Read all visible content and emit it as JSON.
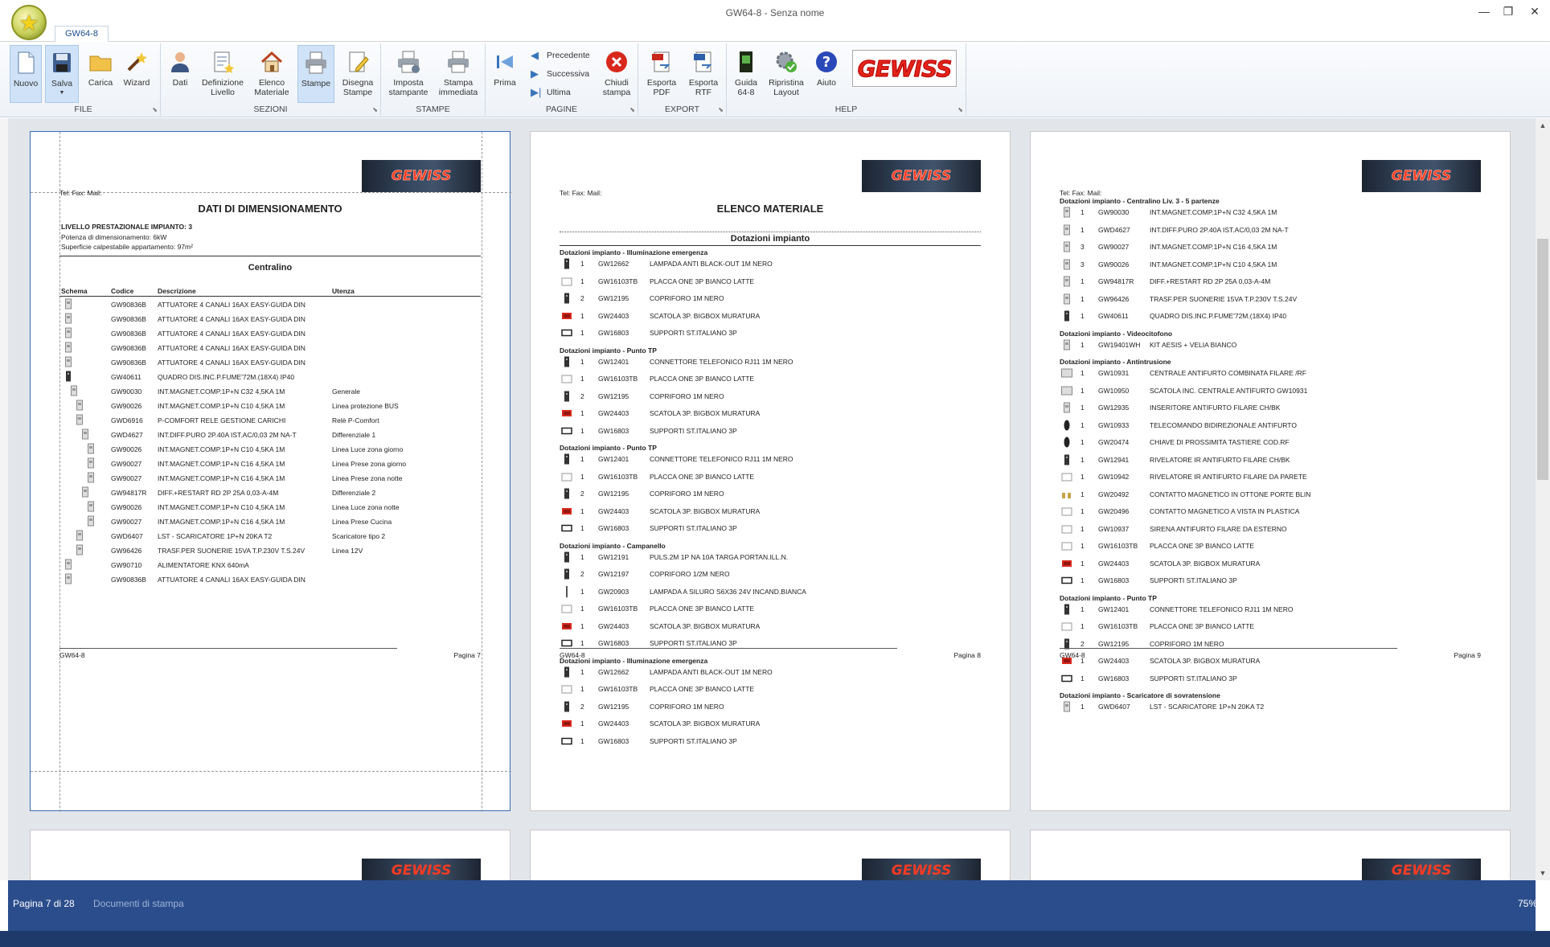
{
  "window": {
    "title": "GW64-8 - Senza nome",
    "tab": "GW64-8"
  },
  "ribbon": {
    "groups": [
      "FILE",
      "SEZIONI",
      "STAMPE",
      "PAGINE",
      "EXPORT",
      "HELP"
    ],
    "buttons": {
      "nuovo": "Nuovo",
      "salva": "Salva",
      "carica": "Carica",
      "wizard": "Wizard",
      "dati": "Dati",
      "definizione": "Definizione\nLivello",
      "elenco": "Elenco\nMateriale",
      "stampe": "Stampe",
      "disegna": "Disegna\nStampe",
      "imposta": "Imposta\nstampante",
      "immediata": "Stampa\nimmediata",
      "prima": "Prima",
      "precedente": "Precedente",
      "successiva": "Successiva",
      "ultima": "Ultima",
      "chiudi": "Chiudi\nstampa",
      "pdf": "Esporta\nPDF",
      "rtf": "Esporta\nRTF",
      "guida": "Guida\n64-8",
      "ripristina": "Ripristina\nLayout",
      "aiuto": "Aiuto"
    },
    "logo": "GEWISS"
  },
  "common": {
    "contact": "Tel:  Fax:  Mail:",
    "logo": "GEWISS",
    "footer_left": "GW64-8"
  },
  "page7": {
    "title": "DATI DI DIMENSIONAMENTO",
    "level": "LIVELLO PRESTAZIONALE IMPIANTO: 3",
    "power": "Potenza di dimensionamento: 6kW",
    "surface": "Superficie calpestabile appartamento: 97m²",
    "section": "Centralino",
    "headers": [
      "Schema",
      "Codice",
      "Descrizione",
      "Utenza"
    ],
    "rows": [
      [
        "0",
        "GW90836B",
        "ATTUATORE 4 CANALI 16AX EASY-GUIDA DIN",
        ""
      ],
      [
        "0",
        "GW90836B",
        "ATTUATORE 4 CANALI 16AX EASY-GUIDA DIN",
        ""
      ],
      [
        "0",
        "GW90836B",
        "ATTUATORE 4 CANALI 16AX EASY-GUIDA DIN",
        ""
      ],
      [
        "0",
        "GW90836B",
        "ATTUATORE 4 CANALI 16AX EASY-GUIDA DIN",
        ""
      ],
      [
        "0",
        "GW90836B",
        "ATTUATORE 4 CANALI 16AX EASY-GUIDA DIN",
        ""
      ],
      [
        "0",
        "GW40611",
        "QUADRO DIS.INC.P.FUME'72M.(18X4) IP40",
        ""
      ],
      [
        "1",
        "GW90030",
        "INT.MAGNET.COMP.1P+N C32 4,5KA 1M",
        "Generale"
      ],
      [
        "2",
        "GW90026",
        "INT.MAGNET.COMP.1P+N C10 4,5KA 1M",
        "Linea protezione BUS"
      ],
      [
        "2",
        "GWD6916",
        "P-COMFORT RELE GESTIONE CARICHI",
        "Relè P-Comfort"
      ],
      [
        "3",
        "GWD4627",
        "INT.DIFF.PURO 2P.40A IST.AC/0,03 2M NA-T",
        "Differenziale 1"
      ],
      [
        "4",
        "GW90026",
        "INT.MAGNET.COMP.1P+N C10 4,5KA 1M",
        "Linea Luce zona giorno"
      ],
      [
        "4",
        "GW90027",
        "INT.MAGNET.COMP.1P+N C16 4,5KA 1M",
        "Linea Prese zona giorno"
      ],
      [
        "4",
        "GW90027",
        "INT.MAGNET.COMP.1P+N C16 4,5KA 1M",
        "Linea Prese zona notte"
      ],
      [
        "3",
        "GW94817R",
        "DIFF.+RESTART RD 2P 25A 0,03-A-4M",
        "Differenziale 2"
      ],
      [
        "4",
        "GW90026",
        "INT.MAGNET.COMP.1P+N C10 4,5KA 1M",
        "Linea Luce zona notte"
      ],
      [
        "4",
        "GW90027",
        "INT.MAGNET.COMP.1P+N C16 4,5KA 1M",
        "Linea Prese Cucina"
      ],
      [
        "2",
        "GWD6407",
        "LST - SCARICATORE 1P+N 20KA T2",
        "Scaricatore tipo 2"
      ],
      [
        "2",
        "GW96426",
        "TRASF.PER SUONERIE 15VA T.P.230V T.S.24V",
        "Linea 12V"
      ],
      [
        "0",
        "GW90710",
        "ALIMENTATORE KNX 640mA",
        ""
      ],
      [
        "0",
        "GW90836B",
        "ATTUATORE 4 CANALI 16AX EASY-GUIDA DIN",
        ""
      ]
    ],
    "footer_right": "Pagina 7"
  },
  "page8": {
    "title": "ELENCO MATERIALE",
    "subtitle": "Dotazioni impianto",
    "groups": [
      {
        "name": "Dotazioni impianto - Illuminazione emergenza",
        "items": [
          [
            "dark",
            "1",
            "GW12662",
            "LAMPADA ANTI BLACK-OUT 1M NERO"
          ],
          [
            "white",
            "1",
            "GW16103TB",
            "PLACCA ONE 3P BIANCO LATTE"
          ],
          [
            "dark",
            "2",
            "GW12195",
            "COPRIFORO 1M NERO"
          ],
          [
            "red",
            "1",
            "GW24403",
            "SCATOLA 3P. BIGBOX MURATURA"
          ],
          [
            "frame",
            "1",
            "GW16803",
            "SUPPORTI ST.ITALIANO 3P"
          ]
        ]
      },
      {
        "name": "Dotazioni impianto - Punto TP",
        "items": [
          [
            "dark",
            "1",
            "GW12401",
            "CONNETTORE TELEFONICO RJ11 1M NERO"
          ],
          [
            "white",
            "1",
            "GW16103TB",
            "PLACCA ONE 3P BIANCO LATTE"
          ],
          [
            "dark",
            "2",
            "GW12195",
            "COPRIFORO 1M NERO"
          ],
          [
            "red",
            "1",
            "GW24403",
            "SCATOLA 3P. BIGBOX MURATURA"
          ],
          [
            "frame",
            "1",
            "GW16803",
            "SUPPORTI ST.ITALIANO 3P"
          ]
        ]
      },
      {
        "name": "Dotazioni impianto - Punto TP",
        "items": [
          [
            "dark",
            "1",
            "GW12401",
            "CONNETTORE TELEFONICO RJ11 1M NERO"
          ],
          [
            "white",
            "1",
            "GW16103TB",
            "PLACCA ONE 3P BIANCO LATTE"
          ],
          [
            "dark",
            "2",
            "GW12195",
            "COPRIFORO 1M NERO"
          ],
          [
            "red",
            "1",
            "GW24403",
            "SCATOLA 3P. BIGBOX MURATURA"
          ],
          [
            "frame",
            "1",
            "GW16803",
            "SUPPORTI ST.ITALIANO 3P"
          ]
        ]
      },
      {
        "name": "Dotazioni impianto - Campanello",
        "items": [
          [
            "dark",
            "1",
            "GW12191",
            "PULS.2M 1P NA 10A TARGA PORTAN.ILL.N."
          ],
          [
            "dark",
            "2",
            "GW12197",
            "COPRIFORO 1/2M NERO"
          ],
          [
            "lamp",
            "1",
            "GW20903",
            "LAMPADA A SILURO S6X36 24V INCAND.BIANCA"
          ],
          [
            "white",
            "1",
            "GW16103TB",
            "PLACCA ONE 3P BIANCO LATTE"
          ],
          [
            "red",
            "1",
            "GW24403",
            "SCATOLA 3P. BIGBOX MURATURA"
          ],
          [
            "frame",
            "1",
            "GW16803",
            "SUPPORTI ST.ITALIANO 3P"
          ]
        ]
      },
      {
        "name": "Dotazioni impianto - Illuminazione emergenza",
        "items": [
          [
            "dark",
            "1",
            "GW12662",
            "LAMPADA ANTI BLACK-OUT 1M NERO"
          ],
          [
            "white",
            "1",
            "GW16103TB",
            "PLACCA ONE 3P BIANCO LATTE"
          ],
          [
            "dark",
            "2",
            "GW12195",
            "COPRIFORO 1M NERO"
          ],
          [
            "red",
            "1",
            "GW24403",
            "SCATOLA 3P. BIGBOX MURATURA"
          ],
          [
            "frame",
            "1",
            "GW16803",
            "SUPPORTI ST.ITALIANO 3P"
          ]
        ]
      }
    ],
    "footer_right": "Pagina 8"
  },
  "page9": {
    "groups": [
      {
        "name": "Dotazioni impianto - Centralino Liv. 3 - 5 partenze",
        "items": [
          [
            "din",
            "1",
            "GW90030",
            "INT.MAGNET.COMP.1P+N C32 4,5KA 1M"
          ],
          [
            "din",
            "1",
            "GWD4627",
            "INT.DIFF.PURO 2P.40A IST.AC/0,03 2M NA-T"
          ],
          [
            "din",
            "3",
            "GW90027",
            "INT.MAGNET.COMP.1P+N C16 4,5KA 1M"
          ],
          [
            "din",
            "3",
            "GW90026",
            "INT.MAGNET.COMP.1P+N C10 4,5KA 1M"
          ],
          [
            "din",
            "1",
            "GW94817R",
            "DIFF.+RESTART RD 2P 25A 0,03-A-4M"
          ],
          [
            "din",
            "1",
            "GW96426",
            "TRASF.PER SUONERIE 15VA T.P.230V T.S.24V"
          ],
          [
            "dark",
            "1",
            "GW40611",
            "QUADRO DIS.INC.P.FUME'72M.(18X4) IP40"
          ]
        ]
      },
      {
        "name": "Dotazioni impianto - Videocitofono",
        "items": [
          [
            "din",
            "1",
            "GW19401WH",
            "KIT AESIS + VELIA BIANCO"
          ]
        ]
      },
      {
        "name": "Dotazioni impianto - Antintrusione",
        "items": [
          [
            "panel",
            "1",
            "GW10931",
            "CENTRALE ANTIFURTO COMBINATA FILARE /RF"
          ],
          [
            "panel",
            "1",
            "GW10950",
            "SCATOLA INC. CENTRALE ANTIFURTO GW10931"
          ],
          [
            "din",
            "1",
            "GW12935",
            "INSERITORE ANTIFURTO FILARE CH/BK"
          ],
          [
            "remote",
            "1",
            "GW10933",
            "TELECOMANDO BIDIREZIONALE ANTIFURTO"
          ],
          [
            "remote",
            "1",
            "GW20474",
            "CHIAVE DI PROSSIMITA TASTIERE COD.RF"
          ],
          [
            "dark",
            "1",
            "GW12941",
            "RIVELATORE IR ANTIFURTO FILARE CH/BK"
          ],
          [
            "white",
            "1",
            "GW10942",
            "RIVELATORE IR ANTIFURTO FILARE DA PARETE"
          ],
          [
            "brass",
            "1",
            "GW20492",
            "CONTATTO MAGNETICO IN OTTONE  PORTE BLIN"
          ],
          [
            "white",
            "1",
            "GW20496",
            "CONTATTO MAGNETICO A VISTA IN PLASTICA"
          ],
          [
            "white",
            "1",
            "GW10937",
            "SIRENA ANTIFURTO FILARE DA ESTERNO"
          ],
          [
            "white",
            "1",
            "GW16103TB",
            "PLACCA ONE 3P BIANCO LATTE"
          ],
          [
            "red",
            "1",
            "GW24403",
            "SCATOLA 3P. BIGBOX MURATURA"
          ],
          [
            "frame",
            "1",
            "GW16803",
            "SUPPORTI ST.ITALIANO 3P"
          ]
        ]
      },
      {
        "name": "Dotazioni impianto - Punto TP",
        "items": [
          [
            "dark",
            "1",
            "GW12401",
            "CONNETTORE TELEFONICO RJ11 1M NERO"
          ],
          [
            "white",
            "1",
            "GW16103TB",
            "PLACCA ONE 3P BIANCO LATTE"
          ],
          [
            "dark",
            "2",
            "GW12195",
            "COPRIFORO 1M NERO"
          ],
          [
            "red",
            "1",
            "GW24403",
            "SCATOLA 3P. BIGBOX MURATURA"
          ],
          [
            "frame",
            "1",
            "GW16803",
            "SUPPORTI ST.ITALIANO 3P"
          ]
        ]
      },
      {
        "name": "Dotazioni impianto - Scaricatore di sovratensione",
        "items": [
          [
            "din",
            "1",
            "GWD6407",
            "LST - SCARICATORE 1P+N 20KA T2"
          ]
        ]
      }
    ],
    "footer_right": "Pagina 9"
  },
  "status": {
    "page": "Pagina 7 di 28",
    "doc": "Documenti di stampa",
    "zoom": "75%"
  },
  "colors": {
    "accent": "#2b4d8c",
    "brand": "#e2231a",
    "selection": "#cfe2f7"
  }
}
